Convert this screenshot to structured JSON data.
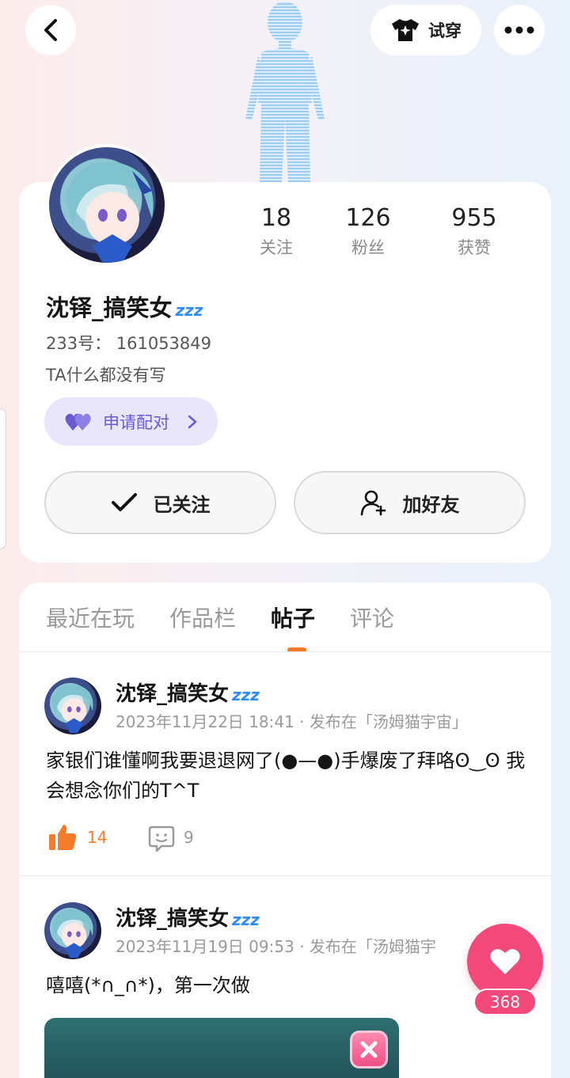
{
  "topbar": {
    "tryon_label": "试穿"
  },
  "profile": {
    "username": "沈铎_搞笑女",
    "username_badge": "zzz",
    "uid": "233号： 161053849",
    "bio": "TA什么都没有写",
    "match_label": "申请配对",
    "follow_label": "已关注",
    "add_friend_label": "加好友",
    "stats": [
      {
        "value": "18",
        "label": "关注"
      },
      {
        "value": "126",
        "label": "粉丝"
      },
      {
        "value": "955",
        "label": "获赞"
      }
    ]
  },
  "tabs": [
    "最近在玩",
    "作品栏",
    "帖子",
    "评论"
  ],
  "active_tab": "帖子",
  "posts": [
    {
      "author": "沈铎_搞笑女",
      "meta": "2023年11月22日 18:41 · 发布在「汤姆猫宇宙」",
      "text": "家银们谁懂啊我要退退网了(●—●)手爆废了拜咯ʘ‿ʘ 我会想念你们的T^T",
      "likes": "14",
      "comments": "9"
    },
    {
      "author": "沈铎_搞笑女",
      "meta": "2023年11月19日 09:53 · 发布在「汤姆猫宇",
      "text": "嘻嘻(*∩_∩*)，第一次做"
    }
  ],
  "fab": {
    "like_count": "368"
  },
  "colors": {
    "accent": "#f57b2a",
    "like_pink": "#f2487a",
    "match_purple": "#6a5bd3",
    "badge_blue": "#2f8cff"
  }
}
